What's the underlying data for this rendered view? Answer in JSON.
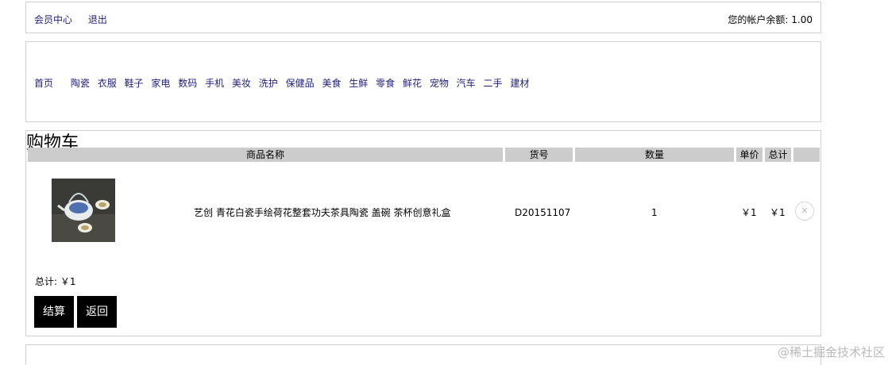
{
  "topbar": {
    "member_center": "会员中心",
    "logout": "退出",
    "balance": "您的帐户余额: 1.00"
  },
  "nav": {
    "home": "首页",
    "categories": [
      "陶瓷",
      "衣服",
      "鞋子",
      "家电",
      "数码",
      "手机",
      "美妆",
      "洗护",
      "保健品",
      "美食",
      "生鲜",
      "零食",
      "鲜花",
      "宠物",
      "汽车",
      "二手",
      "建材"
    ]
  },
  "cart": {
    "title": "购物车",
    "headers": {
      "name": "商品名称",
      "sku": "货号",
      "qty": "数量",
      "price": "单价",
      "total": "总计"
    },
    "items": [
      {
        "name": "艺创 青花白瓷手绘荷花整套功夫茶具陶瓷 盖碗 茶杯创意礼盒",
        "sku": "D20151107",
        "qty": "1",
        "price": "￥1",
        "total": "￥1",
        "remove_icon": "close-icon"
      }
    ],
    "grand_total": "总计: ￥1",
    "checkout_label": "结算",
    "back_label": "返回"
  },
  "watermark": "@稀土掘金技术社区"
}
